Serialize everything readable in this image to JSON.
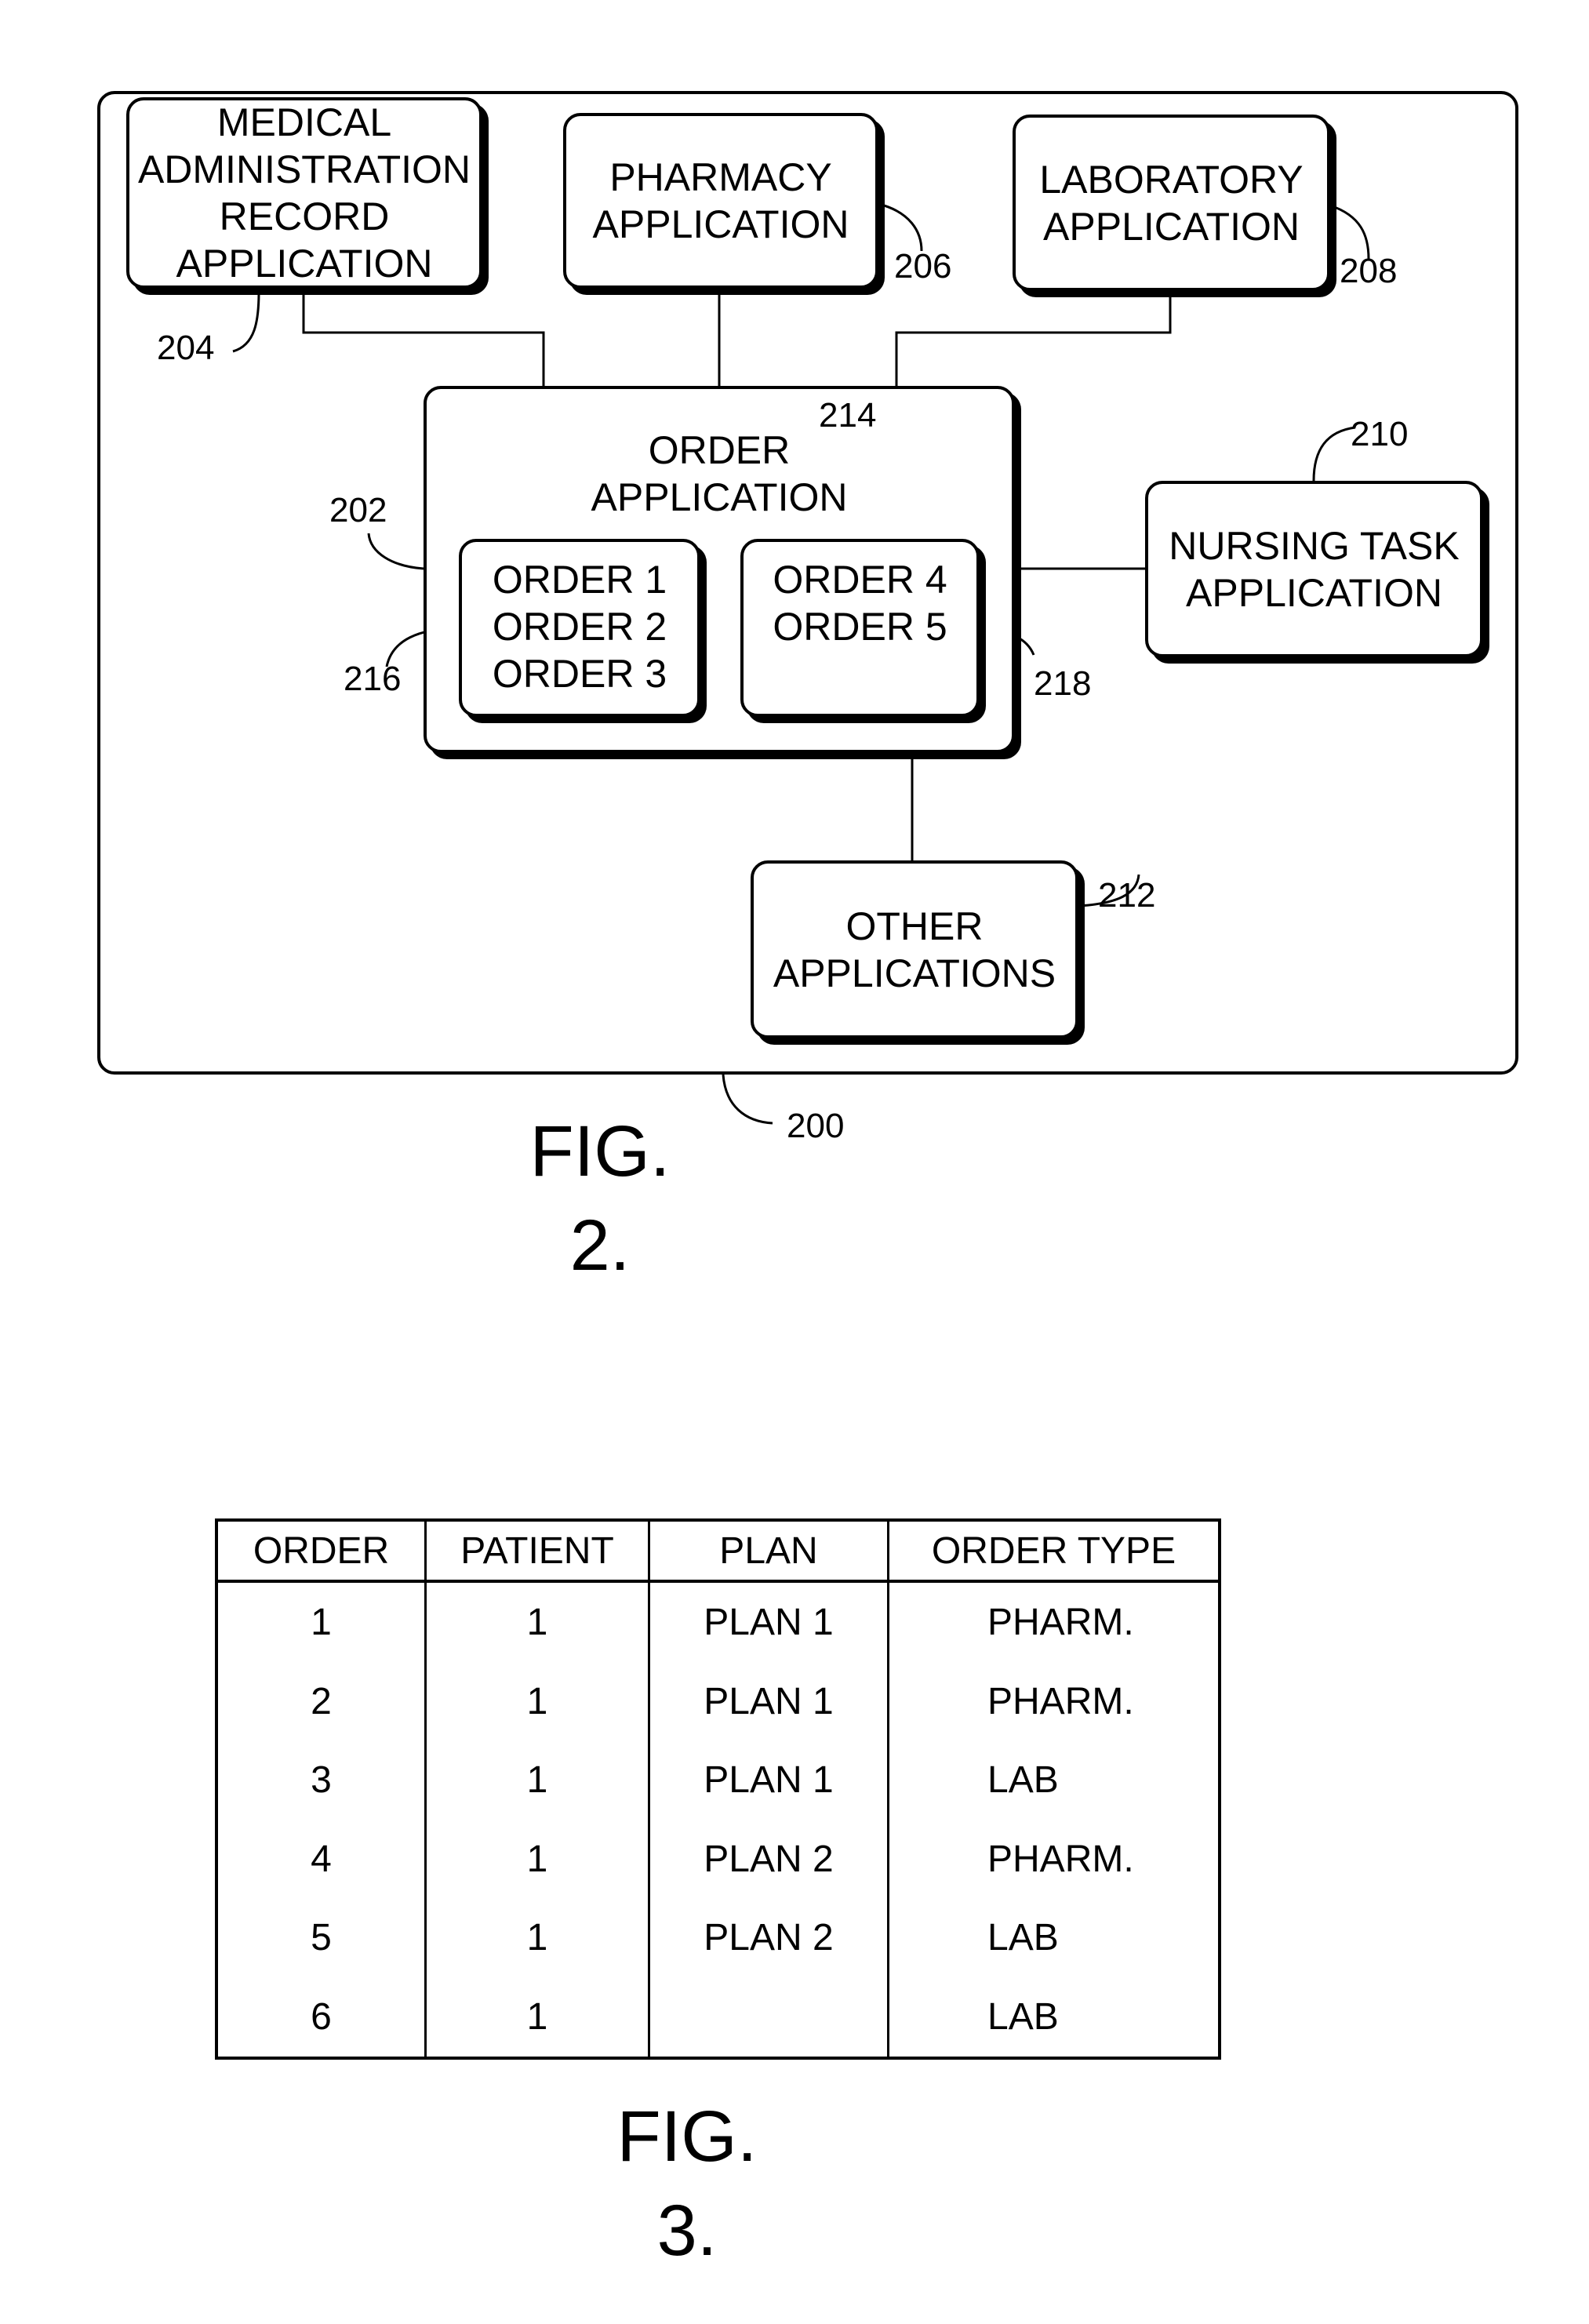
{
  "figure2": {
    "caption_line1": "FIG.",
    "caption_line2": "2.",
    "system_ref": "200",
    "boxes": {
      "mar": {
        "lines": [
          "MEDICAL",
          "ADMINISTRATION",
          "RECORD",
          "APPLICATION"
        ],
        "ref": "204"
      },
      "pharmacy": {
        "lines": [
          "PHARMACY",
          "APPLICATION"
        ],
        "ref": "206"
      },
      "laboratory": {
        "lines": [
          "LABORATORY",
          "APPLICATION"
        ],
        "ref": "208"
      },
      "order_app": {
        "lines": [
          "ORDER",
          "APPLICATION"
        ],
        "ref": "202",
        "database_ref": "214"
      },
      "orders_group_1": {
        "lines": [
          "ORDER 1",
          "ORDER 2",
          "ORDER 3"
        ],
        "ref": "216"
      },
      "orders_group_2": {
        "lines": [
          "ORDER 4",
          "ORDER 5"
        ],
        "ref": "218"
      },
      "nursing": {
        "lines": [
          "NURSING TASK",
          "APPLICATION"
        ],
        "ref": "210"
      },
      "other": {
        "lines": [
          "OTHER",
          "APPLICATIONS"
        ],
        "ref": "212"
      }
    }
  },
  "figure3": {
    "caption_line1": "FIG.",
    "caption_line2": "3.",
    "table": {
      "headers": [
        "ORDER",
        "PATIENT",
        "PLAN",
        "ORDER TYPE"
      ],
      "rows": [
        [
          "1",
          "1",
          "PLAN 1",
          "PHARM."
        ],
        [
          "2",
          "1",
          "PLAN 1",
          "PHARM."
        ],
        [
          "3",
          "1",
          "PLAN 1",
          "LAB"
        ],
        [
          "4",
          "1",
          "PLAN 2",
          "PHARM."
        ],
        [
          "5",
          "1",
          "PLAN 2",
          "LAB"
        ],
        [
          "6",
          "1",
          "",
          "LAB"
        ]
      ]
    }
  }
}
